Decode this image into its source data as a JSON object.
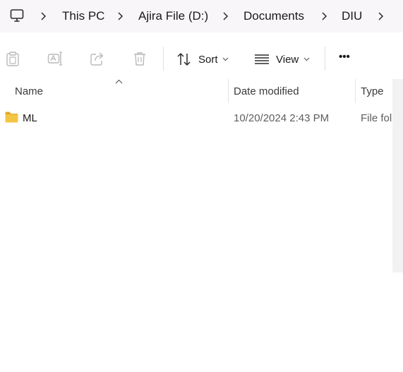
{
  "breadcrumb": {
    "items": [
      "This PC",
      "Ajira File (D:)",
      "Documents",
      "DIU"
    ]
  },
  "toolbar": {
    "sort_label": "Sort",
    "view_label": "View",
    "more_label": "•••"
  },
  "columns": {
    "name": "Name",
    "date_modified": "Date modified",
    "type": "Type"
  },
  "files": [
    {
      "name": "ML",
      "date_modified": "10/20/2024 2:43 PM",
      "type": "File fol"
    }
  ],
  "colors": {
    "breadcrumb_bg": "#f9f6f9",
    "folder_yellow": "#f4c542",
    "disabled_icon": "#b9b9b9",
    "text_secondary": "#5e5e5e"
  }
}
